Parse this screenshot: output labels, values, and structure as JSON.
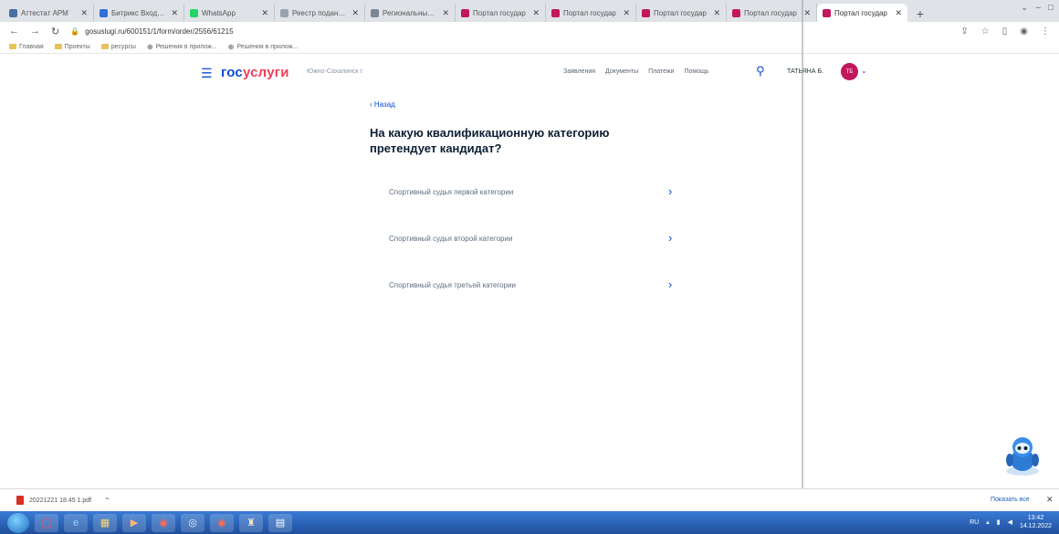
{
  "browser": {
    "tabs": [
      {
        "label": "Аттестат АРМ",
        "favicon_color": "#4a6fa5"
      },
      {
        "label": "Битрикс Входящие",
        "favicon_color": "#2f6fd6"
      },
      {
        "label": "WhatsApp",
        "favicon_color": "#25d366"
      },
      {
        "label": "Реестр поданных",
        "favicon_color": "#9aa3ad"
      },
      {
        "label": "Региональный по",
        "favicon_color": "#7a8694"
      },
      {
        "label": "Портал государ",
        "favicon_color": "#c2185b"
      },
      {
        "label": "Портал государ",
        "favicon_color": "#c2185b"
      },
      {
        "label": "Портал государ",
        "favicon_color": "#c2185b"
      },
      {
        "label": "Портал государ",
        "favicon_color": "#c2185b"
      },
      {
        "label": "Портал государ",
        "favicon_color": "#c2185b"
      }
    ],
    "url": "gosuslugi.ru/600151/1/form/order/2556/61215",
    "bookmarks": [
      {
        "label": "Главная",
        "kind": "folder"
      },
      {
        "label": "Проекты",
        "kind": "folder"
      },
      {
        "label": "ресурсы",
        "kind": "folder"
      },
      {
        "label": "Решения в прилож...",
        "kind": "globe"
      },
      {
        "label": "Решения в прилож...",
        "kind": "globe"
      }
    ]
  },
  "site": {
    "logo_part1": "гос",
    "logo_part2": "услуги",
    "region": "Южно-Сахалинск г",
    "nav": [
      "Заявления",
      "Документы",
      "Платежи",
      "Помощь"
    ],
    "user_name": "ТАТЬЯНА Б.",
    "user_initials": "ТБ"
  },
  "form": {
    "back_label": "Назад",
    "question": "На какую квалификационную категорию претендует кандидат?",
    "options": [
      "Спортивный судья первой категории",
      "Спортивный судья второй категории",
      "Спортивный судья третьей категории"
    ]
  },
  "downloads": {
    "file_name": "20221221 18.45 1.pdf",
    "show_all": "Показать все"
  },
  "taskbar": {
    "lang": "RU",
    "time": "13:42",
    "date": "14.12.2022"
  }
}
